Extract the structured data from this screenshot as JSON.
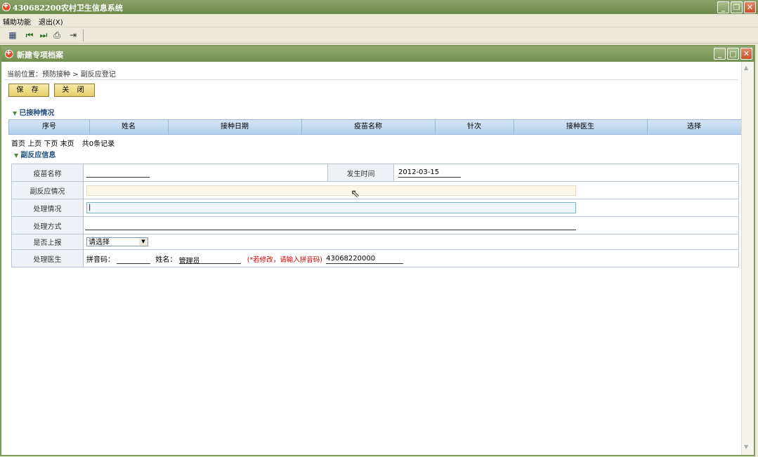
{
  "app": {
    "title": "430682200农村卫生信息系统"
  },
  "menu": {
    "items": [
      "辅助功能",
      "退出(X)"
    ]
  },
  "toolbar": {
    "icons": [
      "calendar-icon",
      "first-icon",
      "next-icon",
      "print-icon",
      "exit-icon"
    ]
  },
  "window": {
    "title": "新建专项档案",
    "breadcrumb": "当前位置：预防接种 > 副反应登记",
    "buttons": {
      "save": "保 存",
      "close": "关 闭"
    }
  },
  "vaccinated": {
    "heading": "已接种情况",
    "columns": [
      "序号",
      "姓名",
      "接种日期",
      "疫苗名称",
      "针次",
      "接种医生",
      "选择"
    ],
    "pager": {
      "first": "首页",
      "prev": "上页",
      "next": "下页",
      "last": "末页",
      "count": "共0条记录"
    }
  },
  "reaction": {
    "heading": "副反应信息",
    "labels": {
      "vaccine_name": "疫苗名称",
      "occur_time": "发生时间",
      "reaction": "副反应情况",
      "handling": "处理情况",
      "method": "处理方式",
      "report": "是否上报",
      "doctor": "处理医生"
    },
    "values": {
      "vaccine_name": "",
      "occur_time": "2012-03-15",
      "reaction": "",
      "handling": "|",
      "method": "",
      "report": "请选择",
      "pinyin_label": "拼音码：",
      "pinyin": "",
      "name_label": "姓名：",
      "name": "管理员",
      "hint": "(*若修改，请输入拼音码)",
      "code": "43068220000"
    }
  },
  "colors": {
    "titlebar": "#7f9a5d",
    "grid_header": "#c3d9ef",
    "button": "#ead27a",
    "hint": "#cc0000"
  }
}
